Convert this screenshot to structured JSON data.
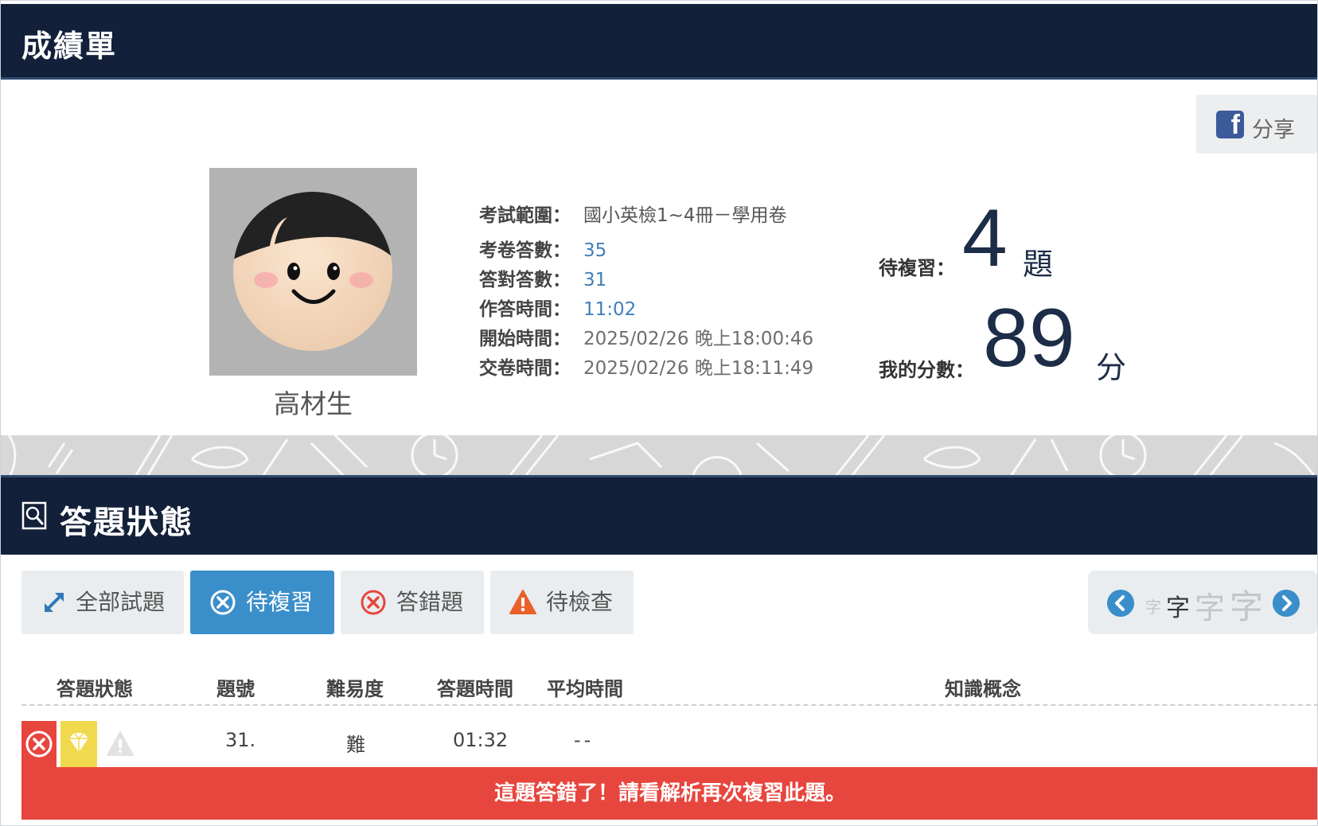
{
  "header": {
    "title": "成績單"
  },
  "share": {
    "label": "分享",
    "icon": "facebook-icon"
  },
  "profile": {
    "name": "高材生"
  },
  "exam_info": [
    {
      "label": "考試範圍：",
      "value": "國小英檢1~4冊－學用卷",
      "style": "plain"
    },
    {
      "label": "考卷答數：",
      "value": "35",
      "style": "blue"
    },
    {
      "label": "答對答數：",
      "value": "31",
      "style": "blue"
    },
    {
      "label": "作答時間：",
      "value": "11:02",
      "style": "blue"
    },
    {
      "label": "開始時間：",
      "value": "2025/02/26 晚上18:00:46",
      "style": "grey"
    },
    {
      "label": "交卷時間：",
      "value": "2025/02/26 晚上18:11:49",
      "style": "grey"
    }
  ],
  "stats": {
    "review_label": "待複習：",
    "review_value": "4",
    "review_unit": "題",
    "score_label": "我的分數：",
    "score_value": "89",
    "score_unit": "分"
  },
  "section": {
    "title": "答題狀態",
    "icon": "search-icon"
  },
  "tabs": [
    {
      "label": "全部試題",
      "icon": "expand-icon"
    },
    {
      "label": "待複習",
      "icon": "close-circle-icon"
    },
    {
      "label": "答錯題",
      "icon": "close-circle-icon"
    },
    {
      "label": "待檢查",
      "icon": "warning-icon"
    }
  ],
  "active_tab": "待複習",
  "font_size_control": {
    "sample": "字"
  },
  "table": {
    "headers": [
      "答題狀態",
      "題號",
      "難易度",
      "答題時間",
      "平均時間",
      "知識概念"
    ],
    "rows": [
      {
        "number": "31.",
        "difficulty": "難",
        "time": "01:32",
        "avg_time": "--",
        "concept": ""
      }
    ]
  },
  "alert": {
    "message": "這題答錯了！請看解析再次複習此題。"
  },
  "colors": {
    "header_bg": "#132039",
    "accent": "#3a8fcb",
    "alert": "#e7463e",
    "score_text": "#1d2d47"
  }
}
